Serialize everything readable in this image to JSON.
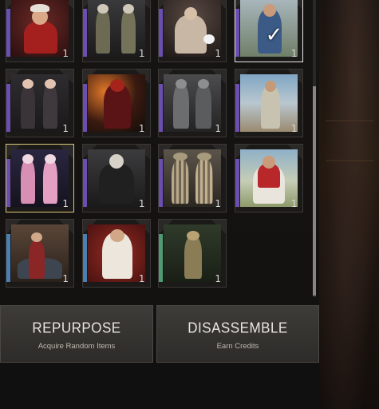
{
  "inventory": {
    "items": [
      {
        "name": "santa-outfit",
        "count": "1",
        "rarity_color": "#6a4fb0",
        "selected": false,
        "checked": false
      },
      {
        "name": "camo-soldier-set",
        "count": "1",
        "rarity_color": "#6a4fb0",
        "selected": false,
        "checked": false
      },
      {
        "name": "snow-character-set",
        "count": "1",
        "rarity_color": "#6a4fb0",
        "selected": false,
        "checked": false
      },
      {
        "name": "casual-outfit",
        "count": "1",
        "rarity_color": "#6a4fb0",
        "selected": false,
        "checked": true
      },
      {
        "name": "bunny-duo-set",
        "count": "1",
        "rarity_color": "#6a4fb0",
        "selected": false,
        "checked": false
      },
      {
        "name": "red-hood-outfit",
        "count": "1",
        "rarity_color": "#6a4fb0",
        "selected": false,
        "checked": false
      },
      {
        "name": "grey-tactical-set",
        "count": "1",
        "rarity_color": "#6a4fb0",
        "selected": false,
        "checked": false
      },
      {
        "name": "desert-outfit",
        "count": "1",
        "rarity_color": "#6a4fb0",
        "selected": false,
        "checked": false
      },
      {
        "name": "pink-bunny-set",
        "count": "1",
        "rarity_color": "#6a4fb0",
        "selected": true,
        "checked": false
      },
      {
        "name": "skull-reaper-outfit",
        "count": "1",
        "rarity_color": "#6a4fb0",
        "selected": false,
        "checked": false
      },
      {
        "name": "striped-duo-set",
        "count": "1",
        "rarity_color": "#6a4fb0",
        "selected": false,
        "checked": false
      },
      {
        "name": "baseball-outfit",
        "count": "1",
        "rarity_color": "#6a4fb0",
        "selected": false,
        "checked": false
      },
      {
        "name": "shop-scene-set",
        "count": "1",
        "rarity_color": "#4a7fb0",
        "selected": false,
        "checked": false
      },
      {
        "name": "white-suit-outfit",
        "count": "1",
        "rarity_color": "#4a7fb0",
        "selected": false,
        "checked": false
      },
      {
        "name": "soldier-field-outfit",
        "count": "1",
        "rarity_color": "#4f9a72",
        "selected": false,
        "checked": false
      }
    ]
  },
  "actions": {
    "repurpose": {
      "title": "REPURPOSE",
      "subtitle": "Acquire Random Items"
    },
    "disassemble": {
      "title": "DISASSEMBLE",
      "subtitle": "Earn Credits"
    }
  },
  "colors": {
    "selected_border": "#d9c87a",
    "checked_border": "#e8e8e8",
    "panel_bg": "#161413"
  }
}
